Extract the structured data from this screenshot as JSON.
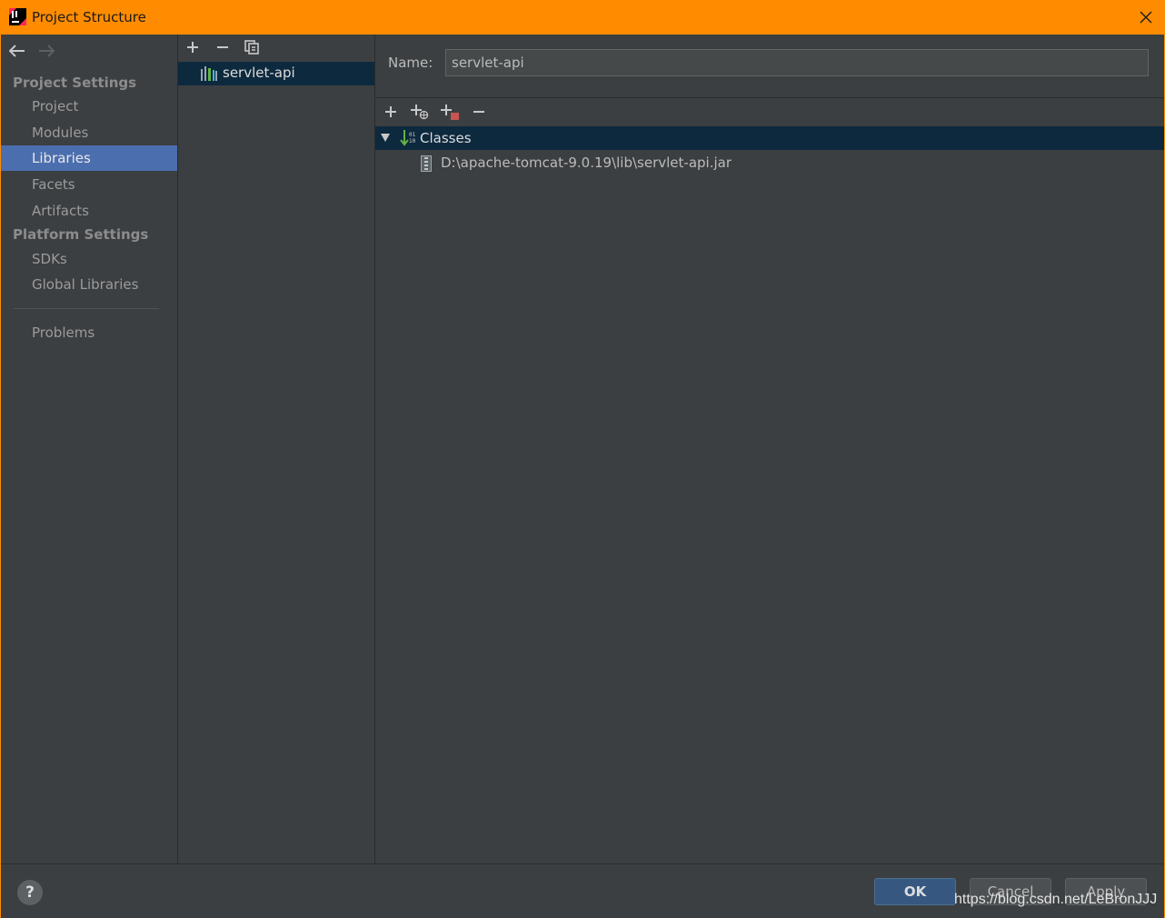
{
  "window": {
    "title": "Project Structure"
  },
  "sidebar": {
    "project_settings_label": "Project Settings",
    "platform_settings_label": "Platform Settings",
    "items": [
      {
        "label": "Project"
      },
      {
        "label": "Modules"
      },
      {
        "label": "Libraries",
        "selected": true
      },
      {
        "label": "Facets"
      },
      {
        "label": "Artifacts"
      },
      {
        "label": "SDKs"
      },
      {
        "label": "Global Libraries"
      },
      {
        "label": "Problems"
      }
    ]
  },
  "libraries": {
    "items": [
      {
        "name": "servlet-api",
        "selected": true
      }
    ]
  },
  "detail": {
    "name_label": "Name:",
    "name_value": "servlet-api",
    "tree": {
      "root_label": "Classes",
      "children": [
        "D:\\apache-tomcat-9.0.19\\lib\\servlet-api.jar"
      ]
    }
  },
  "footer": {
    "help_label": "?",
    "ok_label": "OK",
    "cancel_label": "Cancel",
    "apply_label": "Apply",
    "watermark": "https://blog.csdn.net/LeBronJJJ"
  },
  "colors": {
    "titlebar": "#ff8c00",
    "panel": "#3c3f41",
    "selection": "#4b6eaf",
    "tree_selection": "#0d293e",
    "ok_button": "#365880"
  }
}
